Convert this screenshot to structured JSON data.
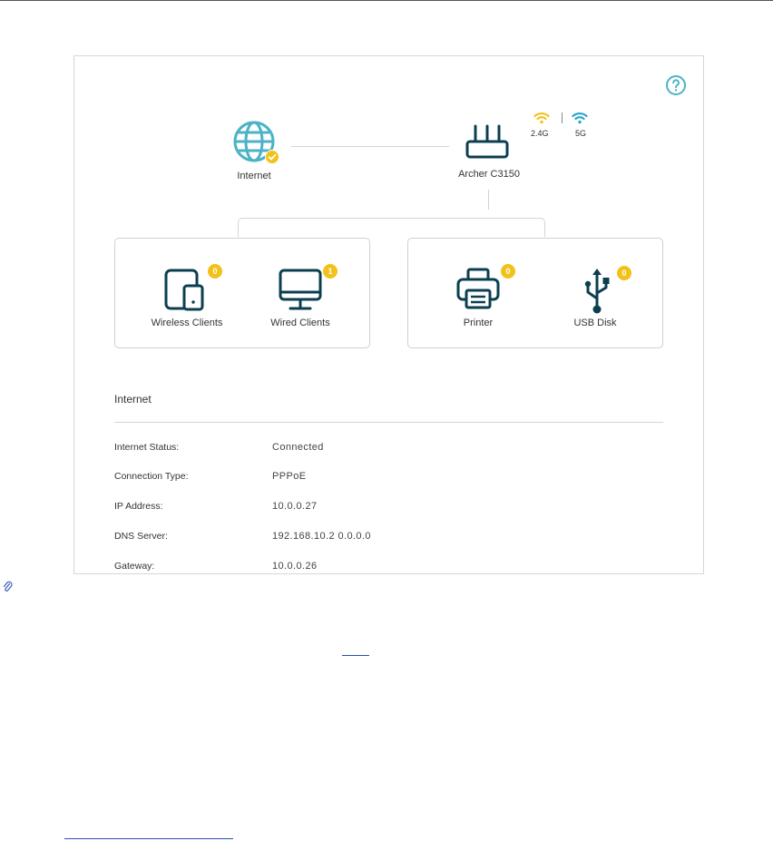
{
  "colors": {
    "accent_teal": "#4bb3c5",
    "icon_navy": "#0b3f4f",
    "badge_yellow": "#f2c21b",
    "wifi_24g": "#f2c21b",
    "wifi_5g": "#2aa7c9"
  },
  "icons": {
    "help": "question-circle-icon",
    "internet": "globe-icon",
    "internet_status": "check-circle-icon",
    "router": "router-icon",
    "wifi_24g": "wifi-icon",
    "wifi_5g": "wifi-icon",
    "wireless_clients": "tablet-phone-icon",
    "wired_clients": "monitor-icon",
    "printer": "printer-icon",
    "usb": "usb-icon",
    "attachment": "paperclip-icon"
  },
  "topology": {
    "internet_label": "Internet",
    "router_label": "Archer C3150",
    "band_24g": "2.4G",
    "band_5g": "5G"
  },
  "clients": [
    {
      "label": "Wireless Clients",
      "count": "0"
    },
    {
      "label": "Wired Clients",
      "count": "1"
    }
  ],
  "devices": [
    {
      "label": "Printer",
      "count": "0"
    },
    {
      "label": "USB Disk",
      "count": "0"
    }
  ],
  "internet_info": {
    "title": "Internet",
    "rows": [
      {
        "label": "Internet Status:",
        "value": "Connected"
      },
      {
        "label": "Connection Type:",
        "value": "PPPoE"
      },
      {
        "label": "IP Address:",
        "value": "10.0.0.27"
      },
      {
        "label": "DNS Server:",
        "value": "192.168.10.2 0.0.0.0"
      },
      {
        "label": "Gateway:",
        "value": "10.0.0.26"
      }
    ]
  }
}
